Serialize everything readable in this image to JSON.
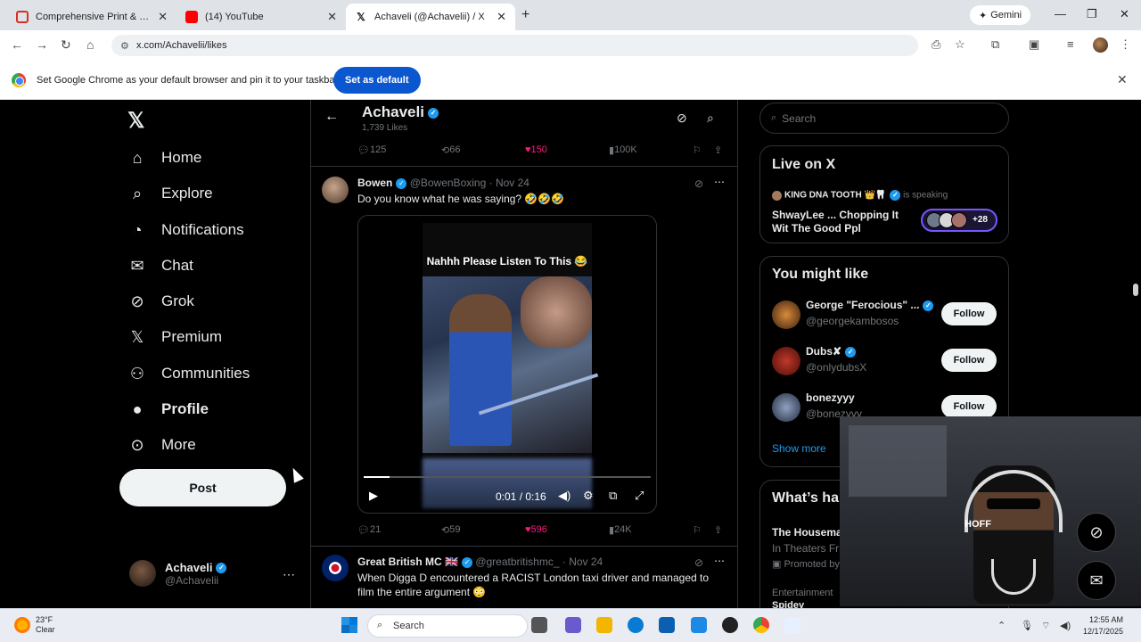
{
  "browser": {
    "tabs": [
      {
        "title": "Comprehensive Print & Marketing",
        "favicon_color": "#d93025"
      },
      {
        "title": "(14) YouTube",
        "favicon_color": "#ff0000"
      },
      {
        "title": "Achaveli (@Achavelii) / X",
        "favicon_color": "#000000",
        "active": true
      }
    ],
    "gemini_label": "Gemini",
    "url": "x.com/Achavelii/likes",
    "banner": {
      "message": "Set Google Chrome as your default browser and pin it to your taskbar",
      "button": "Set as default"
    }
  },
  "sidebar": {
    "logo": "𝕏",
    "items": [
      {
        "label": "Home",
        "icon": "home-icon",
        "glyph": "⌂"
      },
      {
        "label": "Explore",
        "icon": "search-icon",
        "glyph": "⌕"
      },
      {
        "label": "Notifications",
        "icon": "bell-icon",
        "glyph": "🔔"
      },
      {
        "label": "Chat",
        "icon": "mail-icon",
        "glyph": "✉"
      },
      {
        "label": "Grok",
        "icon": "grok-icon",
        "glyph": "⊘"
      },
      {
        "label": "Premium",
        "icon": "x-premium-icon",
        "glyph": "𝕏"
      },
      {
        "label": "Communities",
        "icon": "communities-icon",
        "glyph": "👥"
      },
      {
        "label": "Profile",
        "icon": "person-icon",
        "glyph": "👤"
      },
      {
        "label": "More",
        "icon": "more-icon",
        "glyph": "⋯"
      }
    ],
    "post_button": "Post",
    "account": {
      "name": "Achaveli",
      "handle": "@Achavelii"
    }
  },
  "profile_header": {
    "name": "Achaveli",
    "likes_count": "1,739 Likes"
  },
  "top_actions": {
    "replies": "125",
    "reposts": "66",
    "likes": "150",
    "views": "100K"
  },
  "tweets": [
    {
      "name": "Bowen",
      "handle": "@BowenBoxing",
      "date": "· Nov 24",
      "text": "Do you know what he was saying? 🤣🤣🤣",
      "video": {
        "caption": "Nahhh Please Listen To This 😂",
        "time": "0:01 / 0:16",
        "progress": 0.09
      },
      "actions": {
        "replies": "21",
        "reposts": "59",
        "likes": "596",
        "views": "24K"
      }
    },
    {
      "name": "Great British MC 🇬🇧",
      "handle": "@greatbritishmc_",
      "date": "· Nov 24",
      "text": "When Digga D encountered a RACIST London taxi driver and managed to film the entire argument 😳"
    }
  ],
  "right": {
    "search_placeholder": "Search",
    "live": {
      "title": "Live on X",
      "host": "KING DNA TOOTH 👑🦷",
      "speaking": "is speaking",
      "space_title": "ShwayLee ... Chopping It Wit The Good Ppl",
      "listeners": "+28"
    },
    "might_like": {
      "title": "You might like",
      "users": [
        {
          "name": "George \"Ferocious\" ...",
          "handle": "@georgekambosos",
          "follow": "Follow"
        },
        {
          "name": "Dubs✘",
          "handle": "@onlydubsX",
          "follow": "Follow"
        },
        {
          "name": "bonezyyy",
          "handle": "@bonezyyy",
          "follow": "Follow"
        }
      ],
      "show_more": "Show more"
    },
    "happening": {
      "title": "What’s happening",
      "item_title": "The Housemaid",
      "item_sub": "In Theaters Friday",
      "item_promo": "Promoted by",
      "next_category": "Entertainment",
      "next_title": "Spidey"
    }
  },
  "webcam": {
    "shirt_text": "HOFF"
  },
  "taskbar": {
    "temp": "23°F",
    "condition": "Clear",
    "search": "Search",
    "time": "12:55 AM",
    "date": "12/17/2025"
  }
}
